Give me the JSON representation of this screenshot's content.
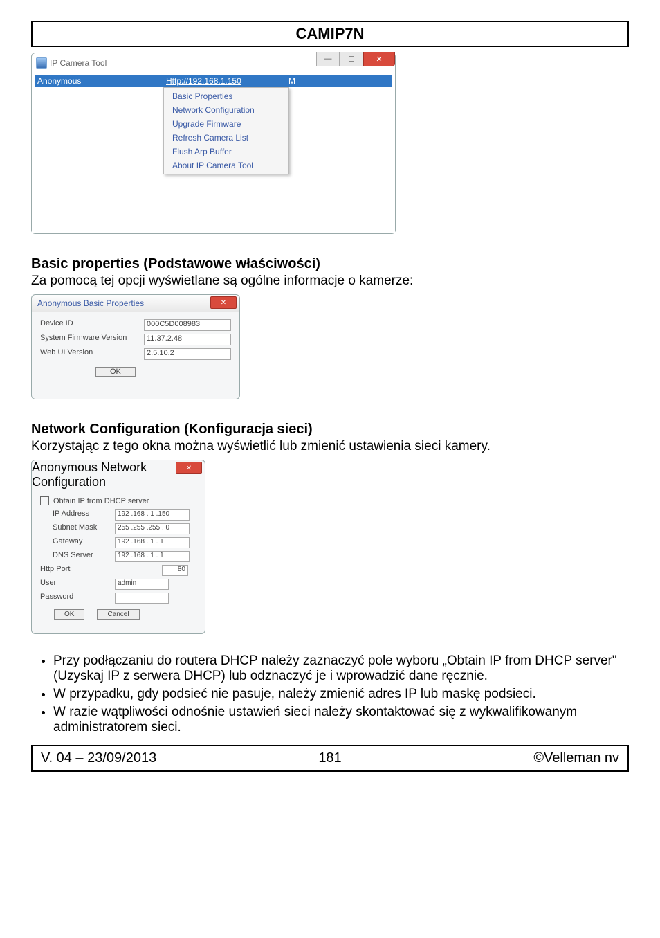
{
  "header": {
    "title": "CAMIP7N"
  },
  "win1": {
    "title": "IP Camera Tool",
    "row": {
      "name": "Anonymous",
      "url": "Http://192.168.1.150",
      "status": "M"
    },
    "menu": [
      "Basic Properties",
      "Network Configuration",
      "Upgrade Firmware",
      "Refresh Camera List",
      "Flush Arp Buffer",
      "About IP Camera Tool"
    ]
  },
  "section1": {
    "heading": "Basic properties (Podstawowe właściwości)",
    "desc": "Za pomocą tej opcji wyświetlane są ogólne informacje o kamerze:"
  },
  "win2": {
    "title": "Anonymous Basic Properties",
    "device_id_label": "Device ID",
    "device_id": "000C5D008983",
    "fw_label": "System Firmware Version",
    "fw": "11.37.2.48",
    "ui_label": "Web UI Version",
    "ui": "2.5.10.2",
    "ok": "OK"
  },
  "section2": {
    "heading": "Network Configuration (Konfiguracja sieci)",
    "desc": "Korzystając z tego okna można wyświetlić lub zmienić ustawienia sieci kamery."
  },
  "win3": {
    "title": "Anonymous Network Configuration",
    "dhcp_label": "Obtain IP from DHCP server",
    "ip_label": "IP Address",
    "ip": "192 .168 . 1  .150",
    "mask_label": "Subnet Mask",
    "mask": "255 .255 .255 . 0",
    "gw_label": "Gateway",
    "gw": "192 .168 . 1  . 1",
    "dns_label": "DNS Server",
    "dns": "192 .168 . 1  . 1",
    "port_label": "Http Port",
    "port": "80",
    "user_label": "User",
    "user": "admin",
    "pwd_label": "Password",
    "ok": "OK",
    "cancel": "Cancel"
  },
  "bullets": [
    "Przy podłączaniu do routera DHCP należy zaznaczyć pole wyboru „Obtain IP from DHCP server\" (Uzyskaj IP z serwera DHCP) lub odznaczyć je i wprowadzić dane ręcznie.",
    "W przypadku, gdy podsieć nie pasuje, należy zmienić adres IP lub maskę podsieci.",
    "W razie wątpliwości odnośnie ustawień sieci należy skontaktować się z wykwalifikowanym administratorem sieci."
  ],
  "footer": {
    "left": "V. 04 – 23/09/2013",
    "center": "181",
    "right": "©Velleman nv"
  }
}
